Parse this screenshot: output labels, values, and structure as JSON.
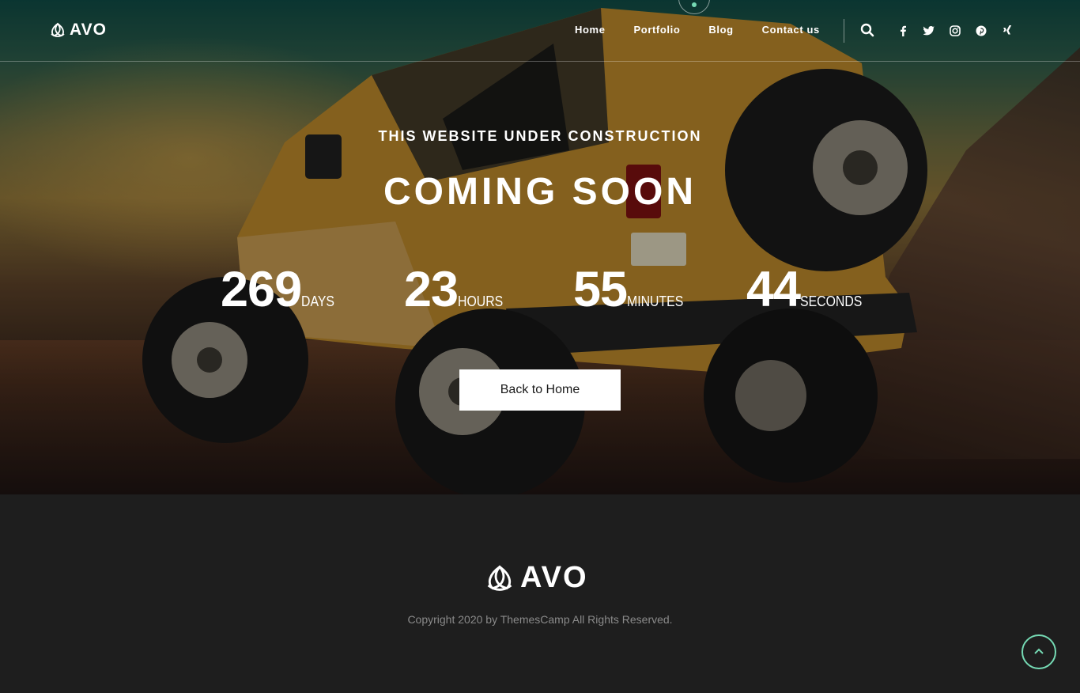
{
  "brand": {
    "name": "AVO"
  },
  "nav": {
    "items": [
      {
        "label": "Home"
      },
      {
        "label": "Portfolio"
      },
      {
        "label": "Blog"
      },
      {
        "label": "Contact us"
      }
    ],
    "socials": [
      "facebook-icon",
      "twitter-icon",
      "instagram-icon",
      "pinterest-icon",
      "xing-icon"
    ]
  },
  "hero": {
    "subtitle": "THIS WEBSITE UNDER CONSTRUCTION",
    "title": "COMING SOON",
    "countdown": [
      {
        "value": "269",
        "unit": "DAYS"
      },
      {
        "value": "23",
        "unit": "HOURS"
      },
      {
        "value": "55",
        "unit": "MINUTES"
      },
      {
        "value": "44",
        "unit": "SECONDS"
      }
    ],
    "button_label": "Back to Home"
  },
  "footer": {
    "copyright": "Copyright 2020 by ThemesCamp All Rights Reserved."
  },
  "colors": {
    "accent": "#75dab4",
    "footer_bg": "#1e1e1e"
  }
}
